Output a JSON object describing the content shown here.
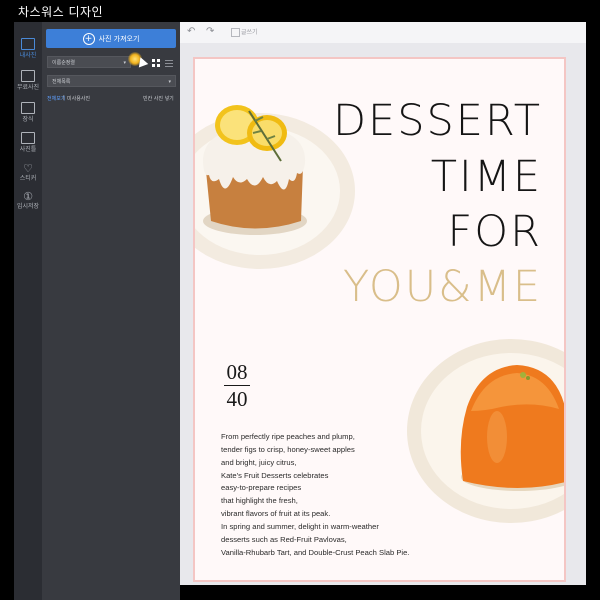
{
  "app": {
    "brand_name": "차스워스 디자인"
  },
  "rail": {
    "items": [
      {
        "label": "내사진",
        "icon": "my-photo-icon",
        "active": true
      },
      {
        "label": "무료사진",
        "icon": "free-photo-icon",
        "active": false
      },
      {
        "label": "장식",
        "icon": "decoration-icon",
        "active": false
      },
      {
        "label": "사진틀",
        "icon": "frame-icon",
        "active": false
      },
      {
        "label": "스티커",
        "icon": "heart-sticker-icon",
        "active": false
      },
      {
        "label": "임시저장",
        "icon": "temp-save-icon",
        "active": false
      }
    ]
  },
  "panel": {
    "upload_label": "사진 가져오기",
    "sort_select": "이름순정렬",
    "album_select": "전체목록",
    "links": [
      "전체보기",
      "미사용사진"
    ],
    "right_link": "빈칸 사진 넣기"
  },
  "toolbar": {
    "undo_icon": "undo-icon",
    "redo_icon": "redo-icon",
    "text_label": "글쓰기"
  },
  "poster": {
    "title_lines": [
      "DESSERT",
      "TIME",
      "FOR"
    ],
    "title_accent": "YOU&ME",
    "date_top": "08",
    "date_bottom": "40",
    "body_lines": [
      "From perfectly ripe peaches and plump,",
      "tender figs to crisp, honey-sweet apples",
      "and bright, juicy citrus,",
      "Kate's Fruit Desserts celebrates",
      "easy-to-prepare recipes",
      "that highlight the fresh,",
      "vibrant flavors of fruit at its peak.",
      "In spring and summer, delight in warm-weather",
      "desserts such as Red-Fruit Pavlovas,",
      "Vanilla-Rhubarb Tart, and Double-Crust Peach Slab Pie."
    ],
    "accent_color": "#d9be8a",
    "border_color": "#f4c6c4"
  },
  "colors": {
    "primary_blue": "#3d7fd8",
    "panel_bg": "#383a40",
    "rail_bg": "#2b2d33"
  }
}
